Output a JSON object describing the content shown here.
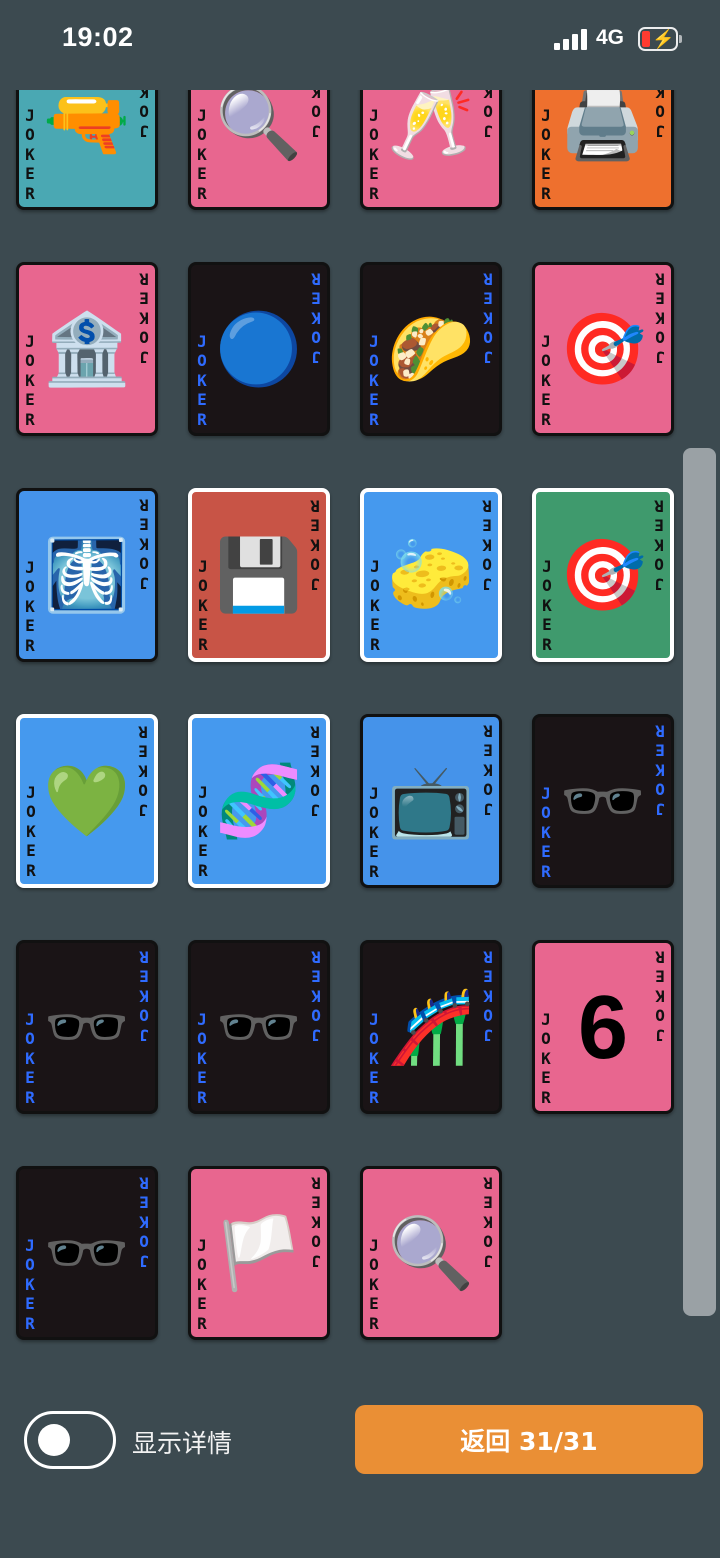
{
  "status_bar": {
    "time": "19:02",
    "network": "4G",
    "battery_color": "#ff3b30"
  },
  "grid": {
    "joker_text": "JOKER",
    "cards": [
      {
        "bg": "#4aa8b3",
        "border": "dark",
        "text_color": "#111",
        "content": "🔫",
        "kind": "emoji",
        "icon": "water-pistol"
      },
      {
        "bg": "#e8668f",
        "border": "dark",
        "text_color": "#111",
        "content": "🔍",
        "kind": "emoji",
        "icon": "magnifying-glass"
      },
      {
        "bg": "#e8668f",
        "border": "dark",
        "text_color": "#111",
        "content": "🥂",
        "kind": "emoji",
        "icon": "champagne-glasses"
      },
      {
        "bg": "#ee702e",
        "border": "dark",
        "text_color": "#111",
        "content": "🖨️",
        "kind": "emoji",
        "icon": "printer"
      },
      {
        "bg": "#e8668f",
        "border": "dark",
        "text_color": "#111",
        "content": "🏦",
        "kind": "emoji",
        "icon": "bank"
      },
      {
        "bg": "#1a1416",
        "border": "dark",
        "text_color": "#2f6bff",
        "content": "🔵",
        "kind": "emoji",
        "icon": "blue-face"
      },
      {
        "bg": "#1a1416",
        "border": "dark",
        "text_color": "#2f6bff",
        "content": "🌮",
        "kind": "emoji",
        "icon": "taco"
      },
      {
        "bg": "#e8668f",
        "border": "dark",
        "text_color": "#111",
        "content": "🎯",
        "kind": "emoji",
        "icon": "dart-target"
      },
      {
        "bg": "#4593ea",
        "border": "dark",
        "text_color": "#111",
        "content": "🩻",
        "kind": "emoji",
        "icon": "x-ray"
      },
      {
        "bg": "#c85446",
        "border": "white",
        "text_color": "#111",
        "content": "💾",
        "kind": "emoji",
        "icon": "floppy-disk"
      },
      {
        "bg": "#4599ee",
        "border": "white",
        "text_color": "#111",
        "content": "🧽",
        "kind": "emoji",
        "icon": "sponge"
      },
      {
        "bg": "#3f9a6d",
        "border": "white",
        "text_color": "#111",
        "content": "🎯",
        "kind": "emoji",
        "icon": "dart-target"
      },
      {
        "bg": "#4599ee",
        "border": "white",
        "text_color": "#111",
        "content": "💚",
        "kind": "emoji",
        "icon": "green-heart"
      },
      {
        "bg": "#4599ee",
        "border": "white",
        "text_color": "#111",
        "content": "🧬",
        "kind": "emoji",
        "icon": "dna"
      },
      {
        "bg": "#4593ea",
        "border": "dark",
        "text_color": "#111",
        "content": "📺",
        "kind": "emoji",
        "icon": "television"
      },
      {
        "bg": "#1a1416",
        "border": "dark",
        "text_color": "#2f6bff",
        "content": "🕶️",
        "kind": "emoji",
        "icon": "sunglasses"
      },
      {
        "bg": "#1a1416",
        "border": "dark",
        "text_color": "#2f6bff",
        "content": "🕶️",
        "kind": "emoji",
        "icon": "sunglasses"
      },
      {
        "bg": "#1a1416",
        "border": "dark",
        "text_color": "#2f6bff",
        "content": "🕶️",
        "kind": "emoji",
        "icon": "sunglasses"
      },
      {
        "bg": "#1a1416",
        "border": "dark",
        "text_color": "#2f6bff",
        "content": "🎢",
        "kind": "emoji",
        "icon": "roller-coaster"
      },
      {
        "bg": "#e8668f",
        "border": "dark",
        "text_color": "#111",
        "content": "6",
        "kind": "number",
        "icon": "number-six"
      },
      {
        "bg": "#1a1416",
        "border": "dark",
        "text_color": "#2f6bff",
        "content": "🕶️",
        "kind": "emoji",
        "icon": "sunglasses"
      },
      {
        "bg": "#e8668f",
        "border": "dark",
        "text_color": "#111",
        "content": "🏳️",
        "kind": "emoji",
        "icon": "white-flag"
      },
      {
        "bg": "#e8668f",
        "border": "dark",
        "text_color": "#111",
        "content": "🔍",
        "kind": "emoji",
        "icon": "magnifying-glass"
      }
    ]
  },
  "controls": {
    "toggle_label": "显示详情",
    "toggle_on": false,
    "back_button_label": "返回 31/31"
  }
}
